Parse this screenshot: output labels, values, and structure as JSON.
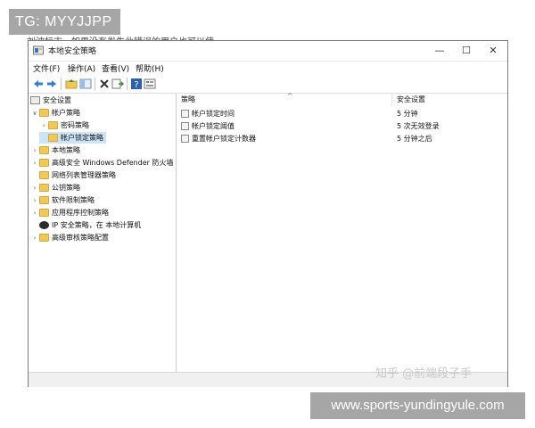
{
  "overlay_top_badge": "TG: MYYJJPP",
  "top_text": "刘波标志，如果没有发生此错误的用户也可以使",
  "window": {
    "title": "本地安全策略",
    "controls": {
      "minimize": "—",
      "maximize": "☐",
      "close": "✕"
    }
  },
  "menu": [
    "文件(F)",
    "操作(A)",
    "查看(V)",
    "帮助(H)"
  ],
  "toolbar": {
    "buttons": [
      "back-arrow-icon",
      "forward-arrow-icon",
      "up-folder-icon",
      "show-tree-icon",
      "delete-icon",
      "export-icon",
      "help-icon",
      "properties-icon"
    ]
  },
  "tree": {
    "items": [
      {
        "label": "安全设置",
        "expander": "",
        "icon": "security-settings-icon"
      },
      {
        "label": "帐户策略",
        "expander": "∨",
        "icon": "folder-icon"
      },
      {
        "label": "密码策略",
        "expander": "›",
        "icon": "folder-lock-icon"
      },
      {
        "label": "帐户锁定策略",
        "expander": "",
        "icon": "folder-lock-icon"
      },
      {
        "label": "本地策略",
        "expander": "›",
        "icon": "folder-icon"
      },
      {
        "label": "高级安全 Windows Defender 防火墙",
        "expander": "›",
        "icon": "folder-icon"
      },
      {
        "label": "网络列表管理器策略",
        "expander": "",
        "icon": "folder-icon"
      },
      {
        "label": "公钥策略",
        "expander": "›",
        "icon": "folder-icon"
      },
      {
        "label": "软件限制策略",
        "expander": "›",
        "icon": "folder-icon"
      },
      {
        "label": "应用程序控制策略",
        "expander": "›",
        "icon": "folder-icon"
      },
      {
        "label": "IP 安全策略，在 本地计算机",
        "expander": "",
        "icon": "ip-security-icon"
      },
      {
        "label": "高级审核策略配置",
        "expander": "›",
        "icon": "folder-icon"
      }
    ]
  },
  "list": {
    "headers": {
      "name": "策略",
      "setting": "安全设置"
    },
    "rows": [
      {
        "name": "帐户锁定时间",
        "setting": "5 分钟"
      },
      {
        "name": "帐户锁定阈值",
        "setting": "5 次无效登录"
      },
      {
        "name": "重置帐户锁定计数器",
        "setting": "5 分钟之后"
      }
    ]
  },
  "scrollbar": {
    "left_arrow": "‹",
    "right_arrow": "›"
  },
  "watermark_zhihu": "知乎 @前端段子手",
  "overlay_bottom_badge": "www.sports-yundingyule.com"
}
